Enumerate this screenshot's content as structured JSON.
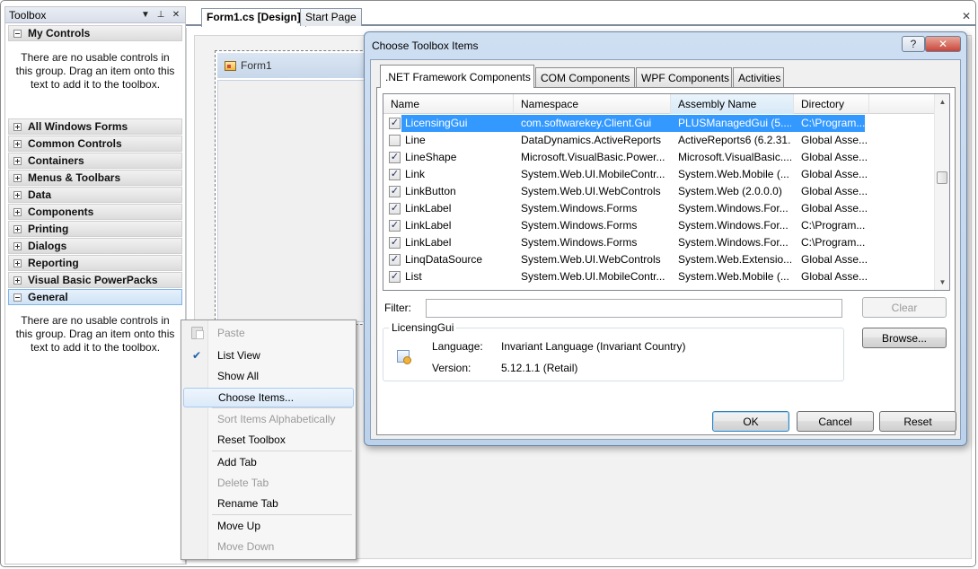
{
  "toolbox": {
    "title": "Toolbox",
    "pin_glyph": "∗",
    "autohide_glyph": "⊥",
    "close_glyph": "✕",
    "my_controls": "My Controls",
    "empty_text": "There are no usable controls in this group. Drag an item onto this text to add it to the toolbox.",
    "groups": [
      "All Windows Forms",
      "Common Controls",
      "Containers",
      "Menus & Toolbars",
      "Data",
      "Components",
      "Printing",
      "Dialogs",
      "Reporting",
      "Visual Basic PowerPacks"
    ],
    "general": "General",
    "general_empty_text": "There are no usable controls in this group. Drag an item onto this text to add it to the toolbox."
  },
  "doc_tabs": {
    "active": "Form1.cs [Design]",
    "inactive": "Start Page",
    "close_glyph": "✕"
  },
  "designer": {
    "form_title": "Form1"
  },
  "context_menu": {
    "items": [
      {
        "label": "Paste",
        "enabled": false
      },
      {
        "label": "List View",
        "enabled": true,
        "checked": true
      },
      {
        "label": "Show All",
        "enabled": true
      },
      {
        "label": "Choose Items...",
        "enabled": true,
        "highlighted": true
      },
      {
        "label": "Sort Items Alphabetically",
        "enabled": false
      },
      {
        "label": "Reset Toolbox",
        "enabled": true
      },
      {
        "label": "Add Tab",
        "enabled": true
      },
      {
        "label": "Delete Tab",
        "enabled": false
      },
      {
        "label": "Rename Tab",
        "enabled": true
      },
      {
        "label": "Move Up",
        "enabled": true
      },
      {
        "label": "Move Down",
        "enabled": false
      }
    ],
    "check_glyph": "✔"
  },
  "dialog": {
    "title": "Choose Toolbox Items",
    "help_glyph": "?",
    "close_glyph": "✕",
    "tabs": [
      ".NET Framework Components",
      "COM Components",
      "WPF Components",
      "Activities"
    ],
    "active_tab": ".NET Framework Components",
    "columns": [
      "Name",
      "Namespace",
      "Assembly Name",
      "Directory"
    ],
    "sorted_column": "Assembly Name",
    "rows": [
      {
        "checked": true,
        "name": "LicensingGui",
        "namespace": "com.softwarekey.Client.Gui",
        "assembly": "PLUSManagedGui (5....",
        "directory": "C:\\Program...",
        "selected": true
      },
      {
        "checked": false,
        "name": "Line",
        "namespace": "DataDynamics.ActiveReports",
        "assembly": "ActiveReports6 (6.2.31...",
        "directory": "Global Asse..."
      },
      {
        "checked": true,
        "name": "LineShape",
        "namespace": "Microsoft.VisualBasic.Power...",
        "assembly": "Microsoft.VisualBasic....",
        "directory": "Global Asse..."
      },
      {
        "checked": true,
        "name": "Link",
        "namespace": "System.Web.UI.MobileContr...",
        "assembly": "System.Web.Mobile (...",
        "directory": "Global Asse..."
      },
      {
        "checked": true,
        "name": "LinkButton",
        "namespace": "System.Web.UI.WebControls",
        "assembly": "System.Web (2.0.0.0)",
        "directory": "Global Asse..."
      },
      {
        "checked": true,
        "name": "LinkLabel",
        "namespace": "System.Windows.Forms",
        "assembly": "System.Windows.For...",
        "directory": "Global Asse..."
      },
      {
        "checked": true,
        "name": "LinkLabel",
        "namespace": "System.Windows.Forms",
        "assembly": "System.Windows.For...",
        "directory": "C:\\Program..."
      },
      {
        "checked": true,
        "name": "LinkLabel",
        "namespace": "System.Windows.Forms",
        "assembly": "System.Windows.For...",
        "directory": "C:\\Program..."
      },
      {
        "checked": true,
        "name": "LinqDataSource",
        "namespace": "System.Web.UI.WebControls",
        "assembly": "System.Web.Extensio...",
        "directory": "Global Asse..."
      },
      {
        "checked": true,
        "name": "List",
        "namespace": "System.Web.UI.MobileContr...",
        "assembly": "System.Web.Mobile (...",
        "directory": "Global Asse..."
      }
    ],
    "scroll_up_glyph": "▲",
    "scroll_down_glyph": "▼",
    "filter_label": "Filter:",
    "filter_value": "",
    "clear_label": "Clear",
    "browse_label": "Browse...",
    "info": {
      "title": "LicensingGui",
      "language_label": "Language:",
      "language_value": "Invariant Language (Invariant Country)",
      "version_label": "Version:",
      "version_value": "5.12.1.1 (Retail)"
    },
    "ok_label": "OK",
    "cancel_label": "Cancel",
    "reset_label": "Reset"
  }
}
